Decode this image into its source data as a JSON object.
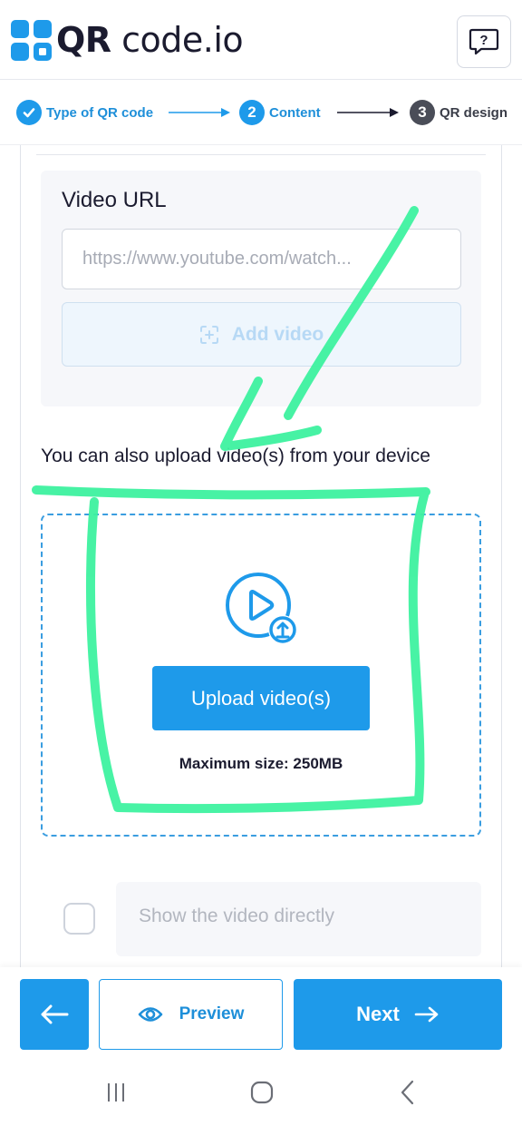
{
  "header": {
    "brand_prefix": "QR",
    "brand_suffix": " code.io",
    "help_label": "?"
  },
  "steps": [
    {
      "number": "✓",
      "label": "Type of QR code",
      "state": "done"
    },
    {
      "number": "2",
      "label": "Content",
      "state": "active"
    },
    {
      "number": "3",
      "label": "QR design",
      "state": "pending"
    }
  ],
  "video_url": {
    "title": "Video URL",
    "placeholder": "https://www.youtube.com/watch...",
    "add_label": "Add video"
  },
  "upload": {
    "hint": "You can also upload video(s) from your device",
    "button_label": "Upload video(s)",
    "max_size": "Maximum size: 250MB"
  },
  "option": {
    "label": "Show the video directly",
    "checked": false
  },
  "bottom_bar": {
    "preview_label": "Preview",
    "next_label": "Next"
  },
  "colors": {
    "accent": "#1e9aea",
    "text": "#1b1b2f",
    "annotation": "#3ef2a0"
  }
}
